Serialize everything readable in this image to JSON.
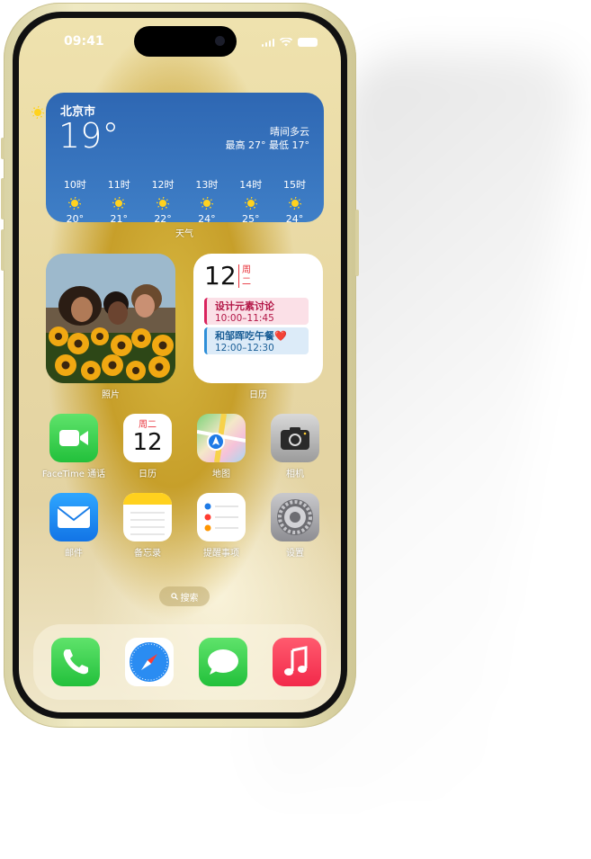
{
  "status_bar": {
    "time": "09:41"
  },
  "weather": {
    "city": "北京市",
    "temp": "19°",
    "condition": "晴间多云",
    "range": "最高 27° 最低 17°",
    "hours": [
      {
        "time": "10时",
        "temp": "20°"
      },
      {
        "time": "11时",
        "temp": "21°"
      },
      {
        "time": "12时",
        "temp": "22°"
      },
      {
        "time": "13时",
        "temp": "24°"
      },
      {
        "time": "14时",
        "temp": "25°"
      },
      {
        "time": "15时",
        "temp": "24°"
      }
    ],
    "label": "天气"
  },
  "photos_widget": {
    "label": "照片"
  },
  "calendar_widget": {
    "day": "12",
    "weekday_1": "周",
    "weekday_2": "二",
    "events": [
      {
        "title": "设计元素讨论",
        "time": "10:00–11:45"
      },
      {
        "title": "和邹晖吃午餐❤️",
        "time": "12:00–12:30"
      }
    ],
    "label": "日历"
  },
  "apps": [
    {
      "label": "FaceTime 通话",
      "icon": "facetime-icon"
    },
    {
      "label": "日历",
      "icon": "calendar-icon",
      "weekday": "周二",
      "day": "12"
    },
    {
      "label": "地图",
      "icon": "maps-icon"
    },
    {
      "label": "相机",
      "icon": "camera-icon"
    },
    {
      "label": "邮件",
      "icon": "mail-icon"
    },
    {
      "label": "备忘录",
      "icon": "notes-icon"
    },
    {
      "label": "提醒事项",
      "icon": "reminders-icon"
    },
    {
      "label": "设置",
      "icon": "settings-icon"
    }
  ],
  "search": {
    "label": "搜索"
  },
  "dock": [
    "phone-icon",
    "safari-icon",
    "messages-icon",
    "music-icon"
  ],
  "colors": {
    "weather_bg": "#3f7fc7",
    "facetime_green": "#22c03b",
    "music_red": "#f2294a",
    "calendar_red": "#e8323a"
  }
}
